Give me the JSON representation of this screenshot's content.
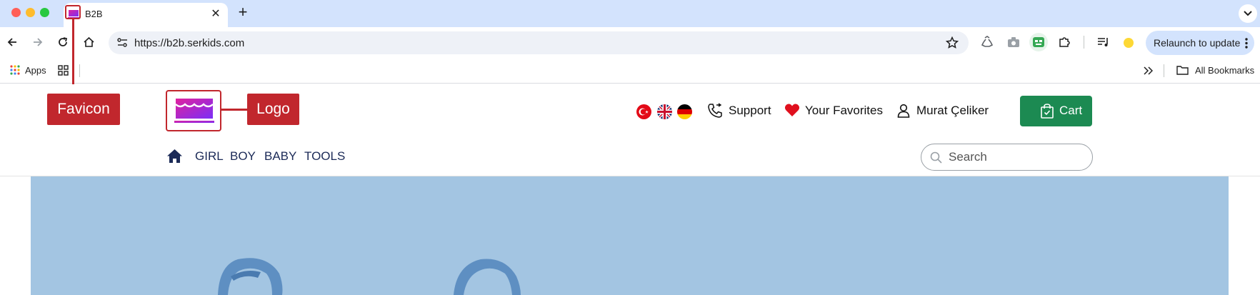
{
  "browser": {
    "tab": {
      "title": "B2B"
    },
    "url": "https://b2b.serkids.com",
    "relaunch_label": "Relaunch to update",
    "bookmarks": {
      "apps_label": "Apps",
      "all_bookmarks_label": "All Bookmarks"
    }
  },
  "annotations": {
    "favicon": "Favicon",
    "logo": "Logo"
  },
  "header": {
    "support": "Support",
    "favorites": "Your Favorites",
    "user_name": "Murat Çeliker",
    "cart": "Cart"
  },
  "nav": {
    "items": [
      "GIRL",
      "BOY",
      "BABY",
      "TOOLS"
    ]
  },
  "search": {
    "placeholder": "Search"
  },
  "colors": {
    "annotation_red": "#c1272d",
    "cart_green": "#1c8a52",
    "nav_navy": "#1b2a57",
    "hero_blue": "#a3c5e2",
    "logo_gradient_start": "#e0219e",
    "logo_gradient_end": "#7b2ff7"
  }
}
